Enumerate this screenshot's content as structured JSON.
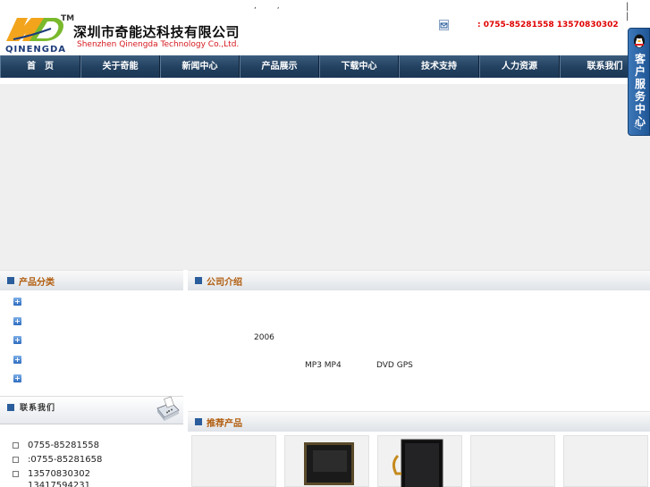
{
  "header": {
    "logo_letters": "QINENGDA",
    "logo_tm": "TM",
    "company_cn": "深圳市奇能达科技有限公司",
    "company_en": "Shenzhen Qinengda Technology Co.,Ltd.",
    "top_links": ", ,",
    "top_bars": "| |",
    "phone": ": 0755-85281558  13570830302"
  },
  "nav": {
    "items": [
      {
        "label": "首　页",
        "w": 90
      },
      {
        "label": "关于奇能",
        "w": 89
      },
      {
        "label": "新闻中心",
        "w": 89
      },
      {
        "label": "产品展示",
        "w": 89
      },
      {
        "label": "下载中心",
        "w": 89
      },
      {
        "label": "技术支持",
        "w": 90
      },
      {
        "label": "人力资源",
        "w": 90
      },
      {
        "label": "联系我们",
        "w": 101
      }
    ]
  },
  "qq_tab": {
    "label": "客户服务中心",
    "arrow": "◁"
  },
  "left": {
    "category_title": "产品分类",
    "category_markers": [
      "+",
      "+",
      "+",
      "+",
      "+"
    ],
    "contact_title": "联系我们",
    "contacts": [
      "0755-85281558",
      ":0755-85281658",
      "13570830302",
      "13417594231"
    ]
  },
  "main": {
    "intro_title": "公司介绍",
    "intro_year": "2006",
    "intro_products_a": "MP3 MP4",
    "intro_products_b": "DVD GPS",
    "recommend_title": "推荐产品"
  },
  "colors": {
    "nav_bg": "#22405f",
    "accent_text": "#b15c0d",
    "phone_red": "#e00000",
    "qq_blue": "#1f5696"
  }
}
